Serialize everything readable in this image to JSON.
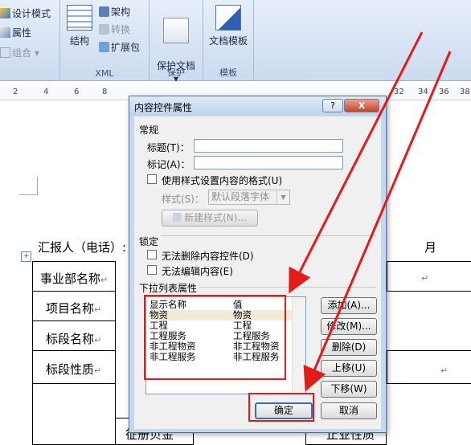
{
  "ribbon": {
    "left_items": [
      "设计模式",
      "属性",
      "组合 ▾"
    ],
    "groups": [
      {
        "name": "XML",
        "big": "结构",
        "small": [
          "架构",
          "转换",
          "扩展包"
        ]
      },
      {
        "name": "保护",
        "big": "保护文档\n▾"
      },
      {
        "name": "模板",
        "big": "文档模板"
      }
    ]
  },
  "ruler": {
    "ticks": [
      "2",
      "4",
      "6",
      "8",
      "10",
      "12",
      "14",
      "16",
      "18",
      "20",
      "22",
      "24",
      "26",
      "28",
      "30",
      "32",
      "34",
      "36",
      "38"
    ]
  },
  "document": {
    "reporter_label": "汇报人（电话）:",
    "month_label": "月",
    "row_labels": [
      "事业部名称",
      "项目名称",
      "标段名称",
      "标段性质"
    ],
    "paragraph_mark": "↵",
    "bottom_left": "征册贝金",
    "bottom_right": "止业性质"
  },
  "dialog": {
    "title": "内容控件属性",
    "help": "?",
    "close": "X",
    "general_heading": "常规",
    "title_label": "标题(T)：",
    "tag_label": "标记(A)：",
    "title_value": "",
    "tag_value": "",
    "use_style_label": "使用样式设置内容的格式(U)",
    "style_label": "样式(S)：",
    "style_value": "默认段落字体",
    "new_style_button": "新建样式(N)...",
    "lock_heading": "锁定",
    "cannot_delete_label": "无法删除内容控件(D)",
    "cannot_edit_label": "无法编辑内容(E)",
    "dropdown_heading": "下拉列表属性",
    "list_headers": {
      "display": "显示名称",
      "value": "值"
    },
    "list_rows": [
      {
        "display": "物资",
        "value": "物资"
      },
      {
        "display": "工程",
        "value": "工程"
      },
      {
        "display": "工程服务",
        "value": "工程服务"
      },
      {
        "display": "非工程物资",
        "value": "非工程物资"
      },
      {
        "display": "非工程服务",
        "value": "非工程服务"
      }
    ],
    "buttons": {
      "add": "添加(A)...",
      "modify": "修改(M)...",
      "delete": "删除(D)",
      "move_up": "上移(U)",
      "move_down": "下移(W)",
      "ok": "确定",
      "cancel": "取消"
    }
  },
  "colors": {
    "annotation": "#e41b1b",
    "ribbon": "#dbe6f5",
    "dialog_frame": "#c7d7ee"
  }
}
